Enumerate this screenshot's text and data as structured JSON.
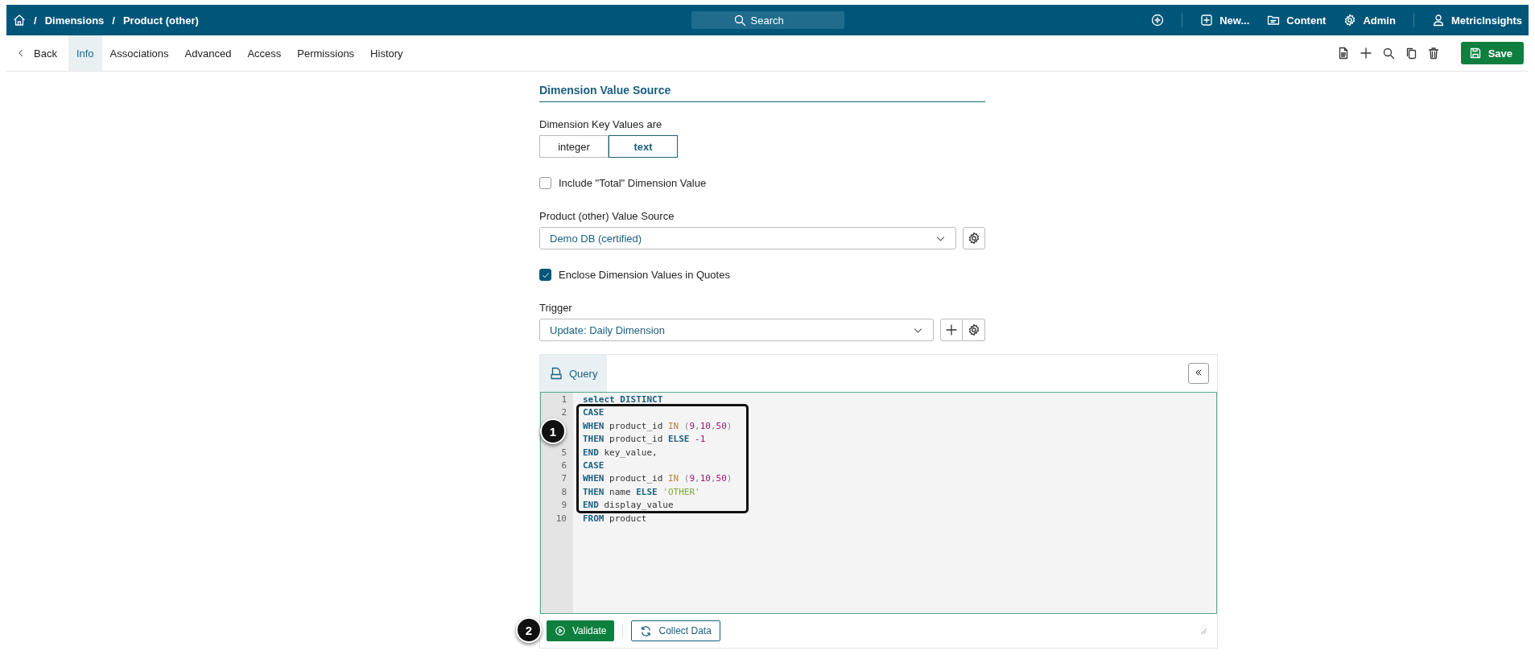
{
  "breadcrumb": [
    {
      "separator": "/",
      "label": "Dimensions"
    },
    {
      "separator": "/",
      "label": "Product (other)"
    }
  ],
  "search": {
    "placeholder": "Search"
  },
  "top_nav": [
    {
      "kind": "new",
      "label": "New..."
    },
    {
      "kind": "content",
      "label": "Content"
    },
    {
      "kind": "admin",
      "label": "Admin"
    },
    {
      "kind": "user",
      "label": "MetricInsights"
    }
  ],
  "back": "Back",
  "tabs": [
    {
      "label": "Info",
      "selected": true
    },
    {
      "label": "Associations",
      "selected": false
    },
    {
      "label": "Advanced",
      "selected": false
    },
    {
      "label": "Access",
      "selected": false
    },
    {
      "label": "Permissions",
      "selected": false
    },
    {
      "label": "History",
      "selected": false
    }
  ],
  "save": "Save",
  "section_title": "Dimension Value Source",
  "key_values": {
    "label": "Dimension Key Values are",
    "options": [
      {
        "label": "integer",
        "selected": false
      },
      {
        "label": "text",
        "selected": true
      }
    ]
  },
  "include_total": {
    "label": "Include \"Total\" Dimension Value",
    "checked": false
  },
  "value_source": {
    "label": "Product (other) Value Source",
    "value": "Demo DB (certified)"
  },
  "enclose_quotes": {
    "label": "Enclose Dimension Values in Quotes",
    "checked": true
  },
  "trigger": {
    "label": "Trigger",
    "value": "Update: Daily Dimension"
  },
  "editor": {
    "tab": {
      "label": "Query",
      "selected": true
    },
    "lines": [
      {
        "number": "1",
        "tokens": [
          {
            "kind": "keyword",
            "text": "select DISTINCT"
          }
        ]
      },
      {
        "number": "2",
        "tokens": [
          {
            "kind": "keyword",
            "text": "CASE"
          }
        ]
      },
      {
        "tokens": [
          {
            "kind": "keyword",
            "text": "WHEN"
          },
          {
            "kind": "plain",
            "text": " product_id "
          },
          {
            "kind": "operator",
            "text": "IN"
          },
          {
            "kind": "paren",
            "text": " ("
          },
          {
            "kind": "number",
            "text": "9"
          },
          {
            "kind": "paren",
            "text": ","
          },
          {
            "kind": "number",
            "text": "10"
          },
          {
            "kind": "paren",
            "text": ","
          },
          {
            "kind": "number",
            "text": "50"
          },
          {
            "kind": "paren",
            "text": ")"
          }
        ]
      },
      {
        "tokens": [
          {
            "kind": "keyword",
            "text": "THEN"
          },
          {
            "kind": "plain",
            "text": " product_id "
          },
          {
            "kind": "keyword",
            "text": "ELSE "
          },
          {
            "kind": "number",
            "text": "-1"
          }
        ]
      },
      {
        "number": "5",
        "tokens": [
          {
            "kind": "keyword",
            "text": "END"
          },
          {
            "kind": "plain",
            "text": " key_value,"
          }
        ]
      },
      {
        "number": "6",
        "tokens": [
          {
            "kind": "keyword",
            "text": "CASE"
          }
        ]
      },
      {
        "number": "7",
        "tokens": [
          {
            "kind": "keyword",
            "text": "WHEN"
          },
          {
            "kind": "plain",
            "text": " product_id "
          },
          {
            "kind": "operator",
            "text": "IN"
          },
          {
            "kind": "paren",
            "text": " ("
          },
          {
            "kind": "number",
            "text": "9"
          },
          {
            "kind": "paren",
            "text": ","
          },
          {
            "kind": "number",
            "text": "10"
          },
          {
            "kind": "paren",
            "text": ","
          },
          {
            "kind": "number",
            "text": "50"
          },
          {
            "kind": "paren",
            "text": ")"
          }
        ]
      },
      {
        "number": "8",
        "tokens": [
          {
            "kind": "keyword",
            "text": "THEN"
          },
          {
            "kind": "plain",
            "text": " name "
          },
          {
            "kind": "keyword",
            "text": "ELSE "
          },
          {
            "kind": "string",
            "text": "'OTHER'"
          }
        ]
      },
      {
        "number": "9",
        "tokens": [
          {
            "kind": "keyword",
            "text": "END"
          },
          {
            "kind": "plain",
            "text": " display_value"
          }
        ]
      },
      {
        "number": "10",
        "tokens": [
          {
            "kind": "keyword",
            "text": "FROM"
          },
          {
            "kind": "plain",
            "text": " product"
          }
        ]
      }
    ],
    "validate": "Validate",
    "collect": "Collect Data"
  },
  "callouts": [
    {
      "label": "1"
    },
    {
      "label": "2"
    }
  ]
}
